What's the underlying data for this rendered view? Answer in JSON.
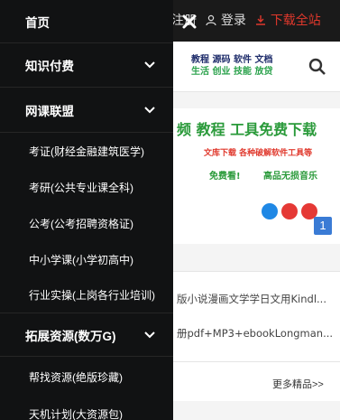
{
  "background": {
    "top_links": {
      "register": "注册",
      "login": "登录",
      "download": "下载全站"
    },
    "nav": {
      "row1": "教程 源码 软件 文档",
      "row2": "生活 创业 技能 放贷"
    },
    "banner": {
      "title": "频 教程 工具免费下载",
      "sub": "文库下载 各种破解软件工具等",
      "free": "免费看!",
      "tag2": "高品无损音乐",
      "badge": "1"
    },
    "list": [
      "版小说漫画文学学日文用Kindl...",
      "册pdf+MP3+ebookLongman..."
    ],
    "more": "更多精品>>"
  },
  "menu": {
    "items": [
      {
        "label": "首页",
        "type": "top"
      },
      {
        "label": "知识付费",
        "type": "top",
        "icon": "chevron-down-icon"
      },
      {
        "label": "网课联盟",
        "type": "top",
        "icon": "chevron-down-icon"
      },
      {
        "label": "考证(财经金融建筑医学)",
        "type": "sub"
      },
      {
        "label": "考研(公共专业课全科)",
        "type": "sub"
      },
      {
        "label": "公考(公考招聘资格证)",
        "type": "sub"
      },
      {
        "label": "中小学课(小学初高中)",
        "type": "sub"
      },
      {
        "label": "行业实操(上岗各行业培训)",
        "type": "sub"
      },
      {
        "label": "拓展资源(数万G)",
        "type": "top",
        "icon": "chevron-down-icon"
      },
      {
        "label": "帮找资源(绝版珍藏)",
        "type": "sub"
      },
      {
        "label": "天机计划(大资源包)",
        "type": "sub"
      }
    ]
  },
  "colors": {
    "menu_bg": "#111213",
    "accent_red": "#e0382c",
    "accent_green": "#2a9a3a"
  }
}
